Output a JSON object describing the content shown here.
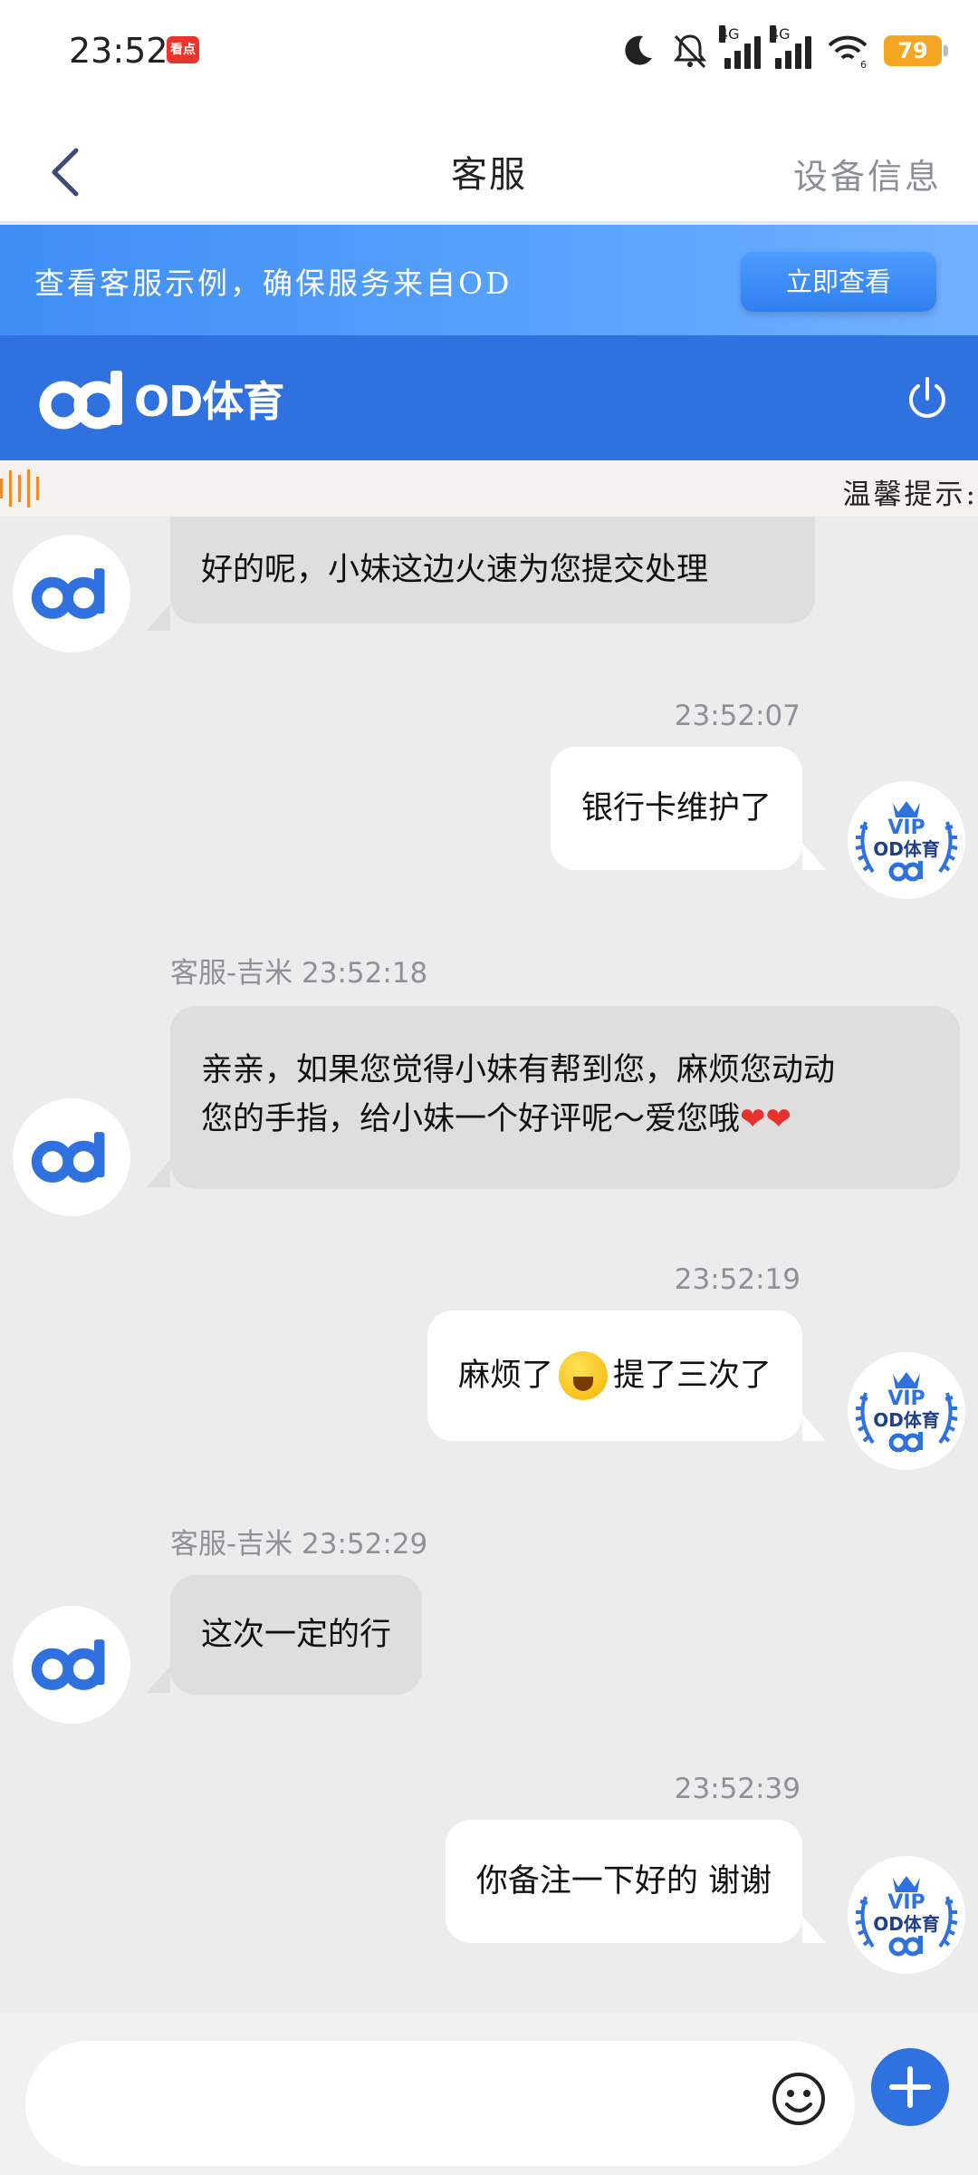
{
  "status_bar": {
    "time": "23:52",
    "news_badge": "看点",
    "network_1": "4G",
    "network_2": "4G",
    "wifi_level": "6",
    "battery": "79"
  },
  "nav": {
    "title": "客服",
    "right_action": "设备信息"
  },
  "notice": {
    "text": "查看客服示例，确保服务来自OD",
    "button": "立即查看"
  },
  "brand": {
    "name": "OD体育"
  },
  "marquee": {
    "text": "温馨提示:"
  },
  "messages": [
    {
      "side": "left",
      "meta": "",
      "text": "好的呢，小妹这边火速为您提交处理"
    },
    {
      "side": "right",
      "meta": "23:52:07",
      "text": "银行卡维护了"
    },
    {
      "side": "left",
      "meta": "客服-吉米  23:52:18",
      "line1": "亲亲，如果您觉得小妹有帮到您，麻烦您动动",
      "line2": "您的手指，给小妹一个好评呢～爱您哦"
    },
    {
      "side": "right",
      "meta": "23:52:19",
      "before_emoji": "麻烦了",
      "after_emoji": "提了三次了"
    },
    {
      "side": "left",
      "meta": "客服-吉米  23:52:29",
      "text": "这次一定的行"
    },
    {
      "side": "right",
      "meta": "23:52:39",
      "text": "你备注一下好的 谢谢"
    }
  ],
  "vip_avatar": {
    "vip": "VIP",
    "brand": "OD体育"
  },
  "input": {
    "placeholder": ""
  },
  "icons": {
    "back": "chevron-left-icon",
    "power": "power-icon",
    "emoji": "smiley-icon",
    "plus": "plus-icon"
  },
  "colors": {
    "brand_blue": "#2f72df",
    "notice_blue": "#4a95f7",
    "battery": "#f5a623",
    "marquee_accent": "#f08a2c"
  }
}
